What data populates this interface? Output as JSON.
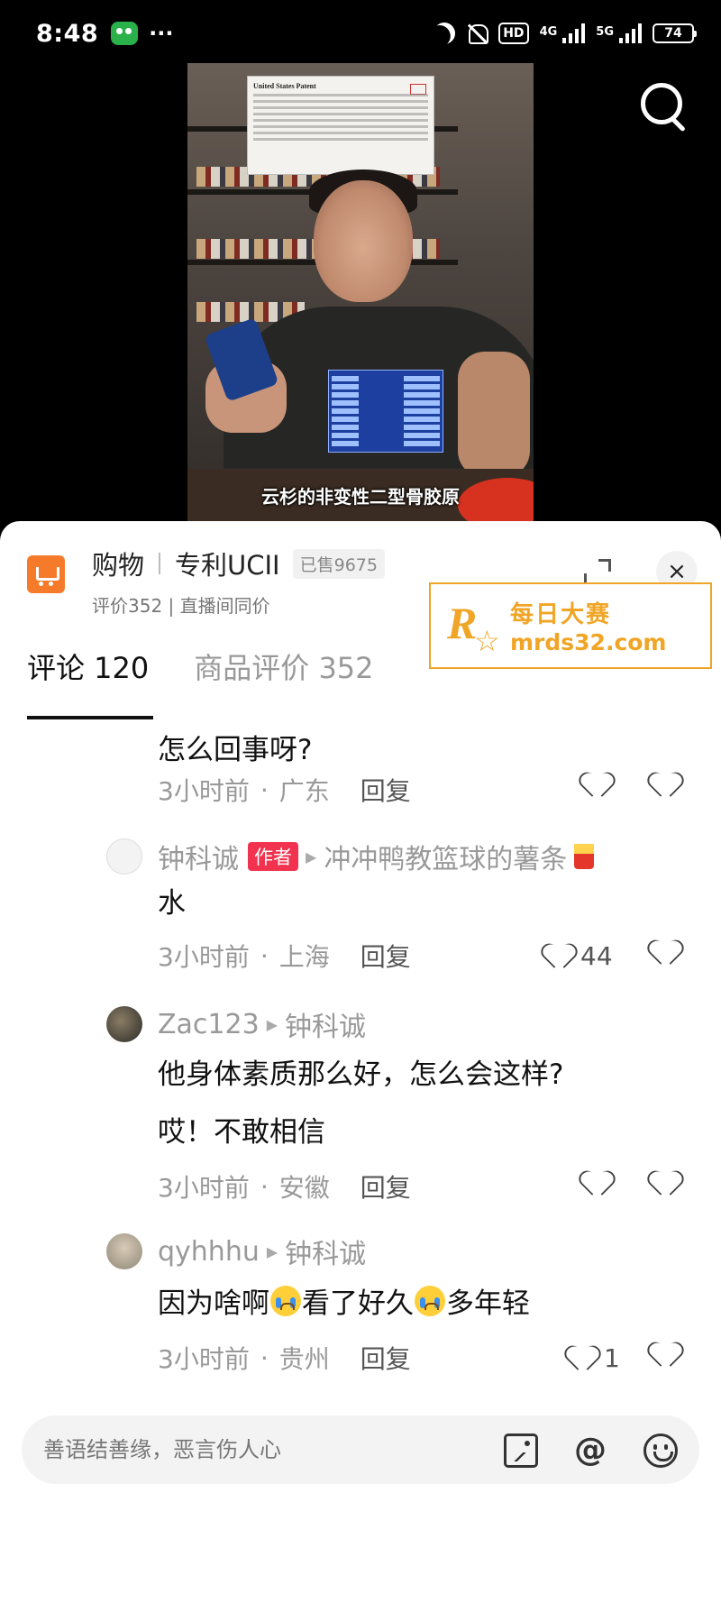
{
  "status_bar": {
    "time": "8:48",
    "hd": "HD",
    "network_4g": "4G",
    "network_5g": "5G",
    "battery": "74"
  },
  "video": {
    "subtitle": "云杉的非变性二型骨胶原",
    "patent_heading": "United States Patent"
  },
  "product": {
    "title": "购物",
    "name": "专利UCII",
    "sold": "已售9675",
    "sub": "评价352 | 直播间同价",
    "close_label": "×"
  },
  "watermark": {
    "logo": "R",
    "chinese": "每日大赛",
    "url": "mrds32.com"
  },
  "tabs": [
    {
      "label": "评论 120",
      "active": true
    },
    {
      "label": "商品评价 352",
      "active": false
    }
  ],
  "comments": [
    {
      "text": "怎么回事呀?",
      "time": "3小时前",
      "location": "广东",
      "reply": "回复",
      "likes": ""
    },
    {
      "user": "钟科诚",
      "badge": "作者",
      "reply_to": "冲冲鸭教篮球的薯条",
      "text": "水",
      "time": "3小时前",
      "location": "上海",
      "reply": "回复",
      "likes": "44"
    },
    {
      "user": "Zac123",
      "reply_to": "钟科诚",
      "text_line1": "他身体素质那么好，怎么会这样?",
      "text_line2": "哎！不敢相信",
      "time": "3小时前",
      "location": "安徽",
      "reply": "回复",
      "likes": ""
    },
    {
      "user": "qyhhhu",
      "reply_to": "钟科诚",
      "text_a": "因为啥啊",
      "text_b": "看了好久",
      "text_c": "多年轻",
      "time": "3小时前",
      "location": "贵州",
      "reply": "回复",
      "likes": "1"
    }
  ],
  "input": {
    "placeholder": "善语结善缘，恶言伤人心"
  },
  "icons": {
    "search": "search-icon",
    "expand": "expand-icon",
    "close": "close-icon",
    "cart": "cart-icon",
    "image": "image-icon",
    "at": "at-icon",
    "emoji": "emoji-icon"
  },
  "colors": {
    "accent_orange": "#f57b2a",
    "author_badge": "#f2334f",
    "watermark": "#f0a526"
  }
}
